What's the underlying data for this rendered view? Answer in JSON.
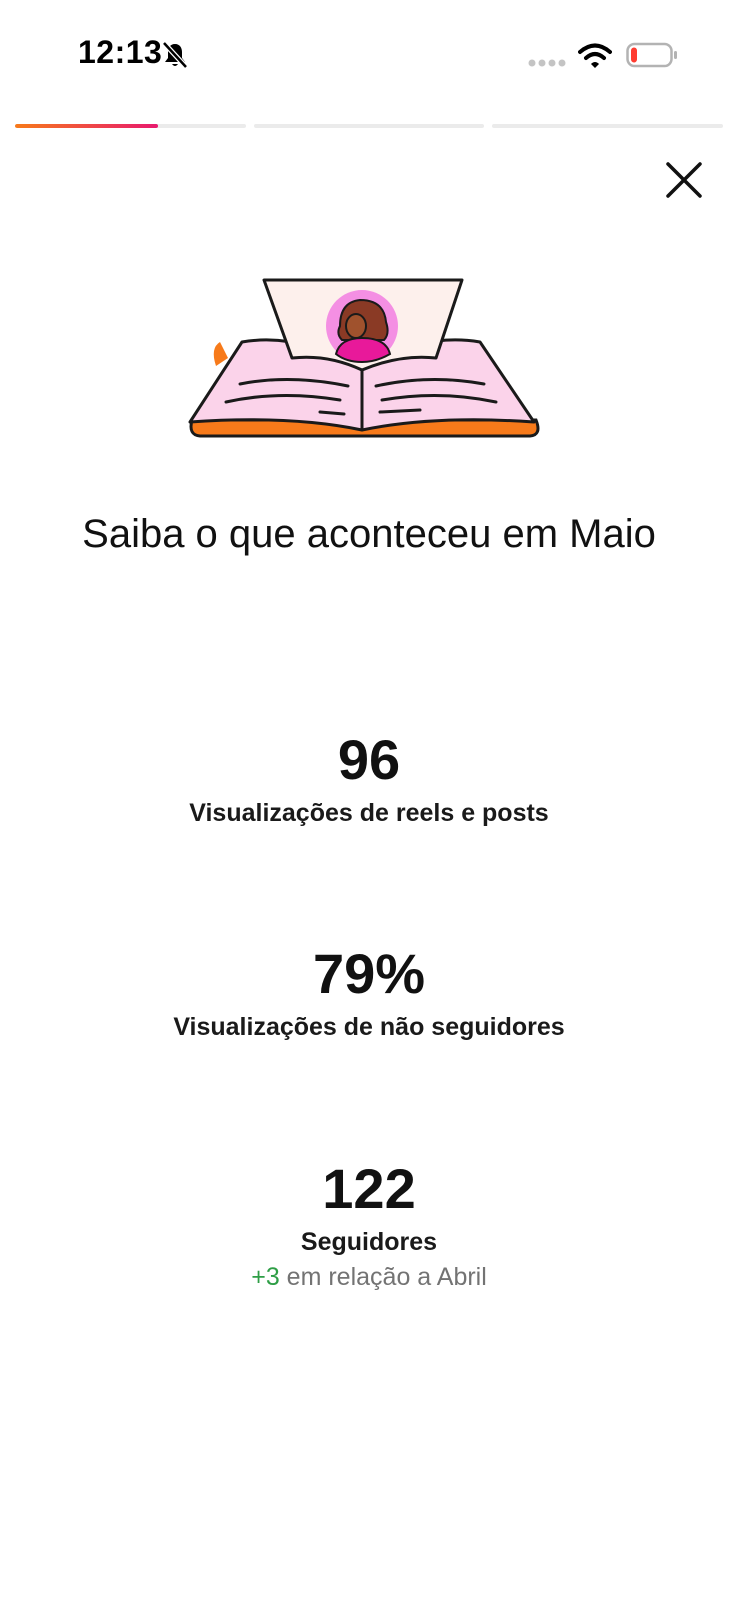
{
  "status_bar": {
    "time": "12:13",
    "battery_color": "#ff3b30"
  },
  "stories": {
    "segments": [
      {
        "progress": 0.62
      },
      {
        "progress": 0
      },
      {
        "progress": 0
      }
    ]
  },
  "icons": {
    "close": "close-icon",
    "bell_off": "bell-slash-icon",
    "wifi": "wifi-icon",
    "battery": "battery-icon",
    "signal": "signal-icon"
  },
  "headline": {
    "text": "Saiba o que aconteceu em Maio"
  },
  "stats": [
    {
      "value": "96",
      "label": "Visualizações de reels e posts"
    },
    {
      "value": "79%",
      "label": "Visualizações de não seguidores"
    },
    {
      "value": "122",
      "label": "Seguidores",
      "delta": "+3",
      "compare_text": " em relação a Abril"
    }
  ],
  "colors": {
    "accent_gradient_start": "#f77a1a",
    "accent_gradient_end": "#e8196e",
    "positive": "#2e9e46",
    "muted": "#737373"
  }
}
